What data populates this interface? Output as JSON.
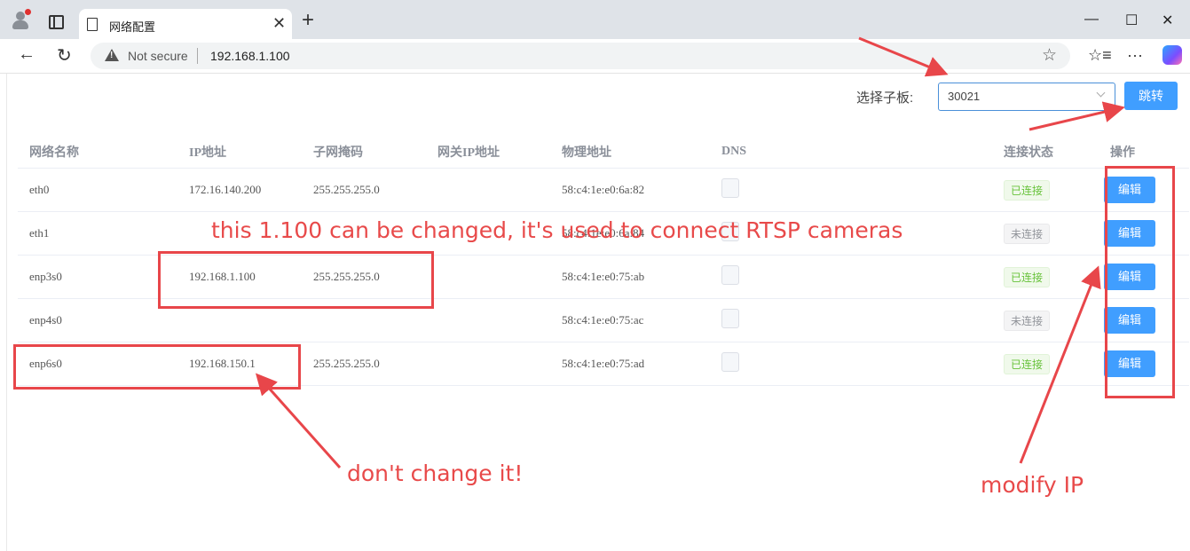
{
  "browser": {
    "tab_title": "网络配置",
    "not_secure_label": "Not secure",
    "url": "192.168.1.100"
  },
  "toolbar": {
    "board_label": "选择子板:",
    "board_value": "30021",
    "jump_button": "跳转"
  },
  "table": {
    "columns": [
      "网络名称",
      "IP地址",
      "子网掩码",
      "网关IP地址",
      "物理地址",
      "DNS",
      "连接状态",
      "操作"
    ],
    "rows": [
      {
        "name": "eth0",
        "ip": "172.16.140.200",
        "mask": "255.255.255.0",
        "gateway": "",
        "mac": "58:c4:1e:e0:6a:82",
        "status": "已连接",
        "connected": true,
        "action": "编辑"
      },
      {
        "name": "eth1",
        "ip": "",
        "mask": "",
        "gateway": "",
        "mac": "58:c4:1e:e0:6a:84",
        "status": "未连接",
        "connected": false,
        "action": "编辑"
      },
      {
        "name": "enp3s0",
        "ip": "192.168.1.100",
        "mask": "255.255.255.0",
        "gateway": "",
        "mac": "58:c4:1e:e0:75:ab",
        "status": "已连接",
        "connected": true,
        "action": "编辑"
      },
      {
        "name": "enp4s0",
        "ip": "",
        "mask": "",
        "gateway": "",
        "mac": "58:c4:1e:e0:75:ac",
        "status": "未连接",
        "connected": false,
        "action": "编辑"
      },
      {
        "name": "enp6s0",
        "ip": "192.168.150.1",
        "mask": "255.255.255.0",
        "gateway": "",
        "mac": "58:c4:1e:e0:75:ad",
        "status": "已连接",
        "connected": true,
        "action": "编辑"
      }
    ]
  },
  "annotations": {
    "note_top": "this 1.100 can be changed, it's used to connect RTSP cameras",
    "note_bottom": "don't change it!",
    "note_right": "modify IP"
  },
  "colors": {
    "primary": "#409eff",
    "annotation": "#e8464a"
  }
}
